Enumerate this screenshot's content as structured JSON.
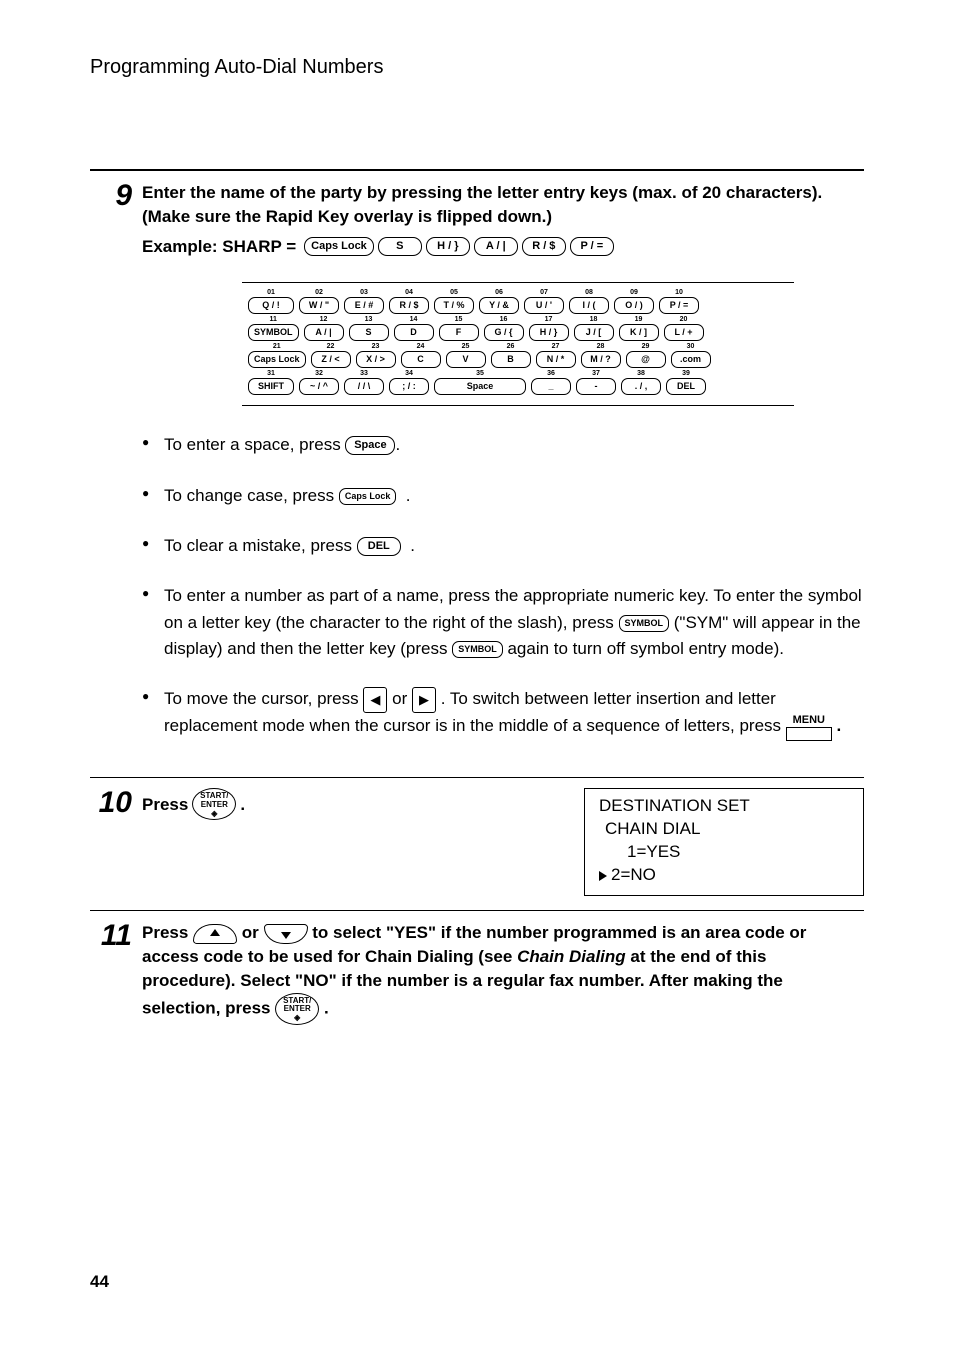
{
  "header": "Programming Auto-Dial Numbers",
  "step9": {
    "num": "9",
    "instruction_line1": "Enter the name of the party by pressing the letter entry keys (max. of 20 characters). (Make sure the Rapid Key overlay is flipped down.)",
    "example_prefix": "Example: SHARP =",
    "example_keys": [
      "Caps Lock",
      "S",
      "H / }",
      "A / |",
      "R / $",
      "P / ="
    ],
    "keyboard": {
      "row1": [
        {
          "n": "01",
          "l": "Q / !"
        },
        {
          "n": "02",
          "l": "W / \""
        },
        {
          "n": "03",
          "l": "E / #"
        },
        {
          "n": "04",
          "l": "R / $"
        },
        {
          "n": "05",
          "l": "T / %"
        },
        {
          "n": "06",
          "l": "Y / &"
        },
        {
          "n": "07",
          "l": "U / '"
        },
        {
          "n": "08",
          "l": "I / ("
        },
        {
          "n": "09",
          "l": "O / )"
        },
        {
          "n": "10",
          "l": "P / ="
        }
      ],
      "row2": [
        {
          "n": "11",
          "l": "SYMBOL"
        },
        {
          "n": "12",
          "l": "A / |"
        },
        {
          "n": "13",
          "l": "S"
        },
        {
          "n": "14",
          "l": "D"
        },
        {
          "n": "15",
          "l": "F"
        },
        {
          "n": "16",
          "l": "G / {"
        },
        {
          "n": "17",
          "l": "H / }"
        },
        {
          "n": "18",
          "l": "J / ["
        },
        {
          "n": "19",
          "l": "K / ]"
        },
        {
          "n": "20",
          "l": "L / +"
        }
      ],
      "row3": [
        {
          "n": "21",
          "l": "Caps Lock"
        },
        {
          "n": "22",
          "l": "Z / <"
        },
        {
          "n": "23",
          "l": "X / >"
        },
        {
          "n": "24",
          "l": "C"
        },
        {
          "n": "25",
          "l": "V"
        },
        {
          "n": "26",
          "l": "B"
        },
        {
          "n": "27",
          "l": "N / *"
        },
        {
          "n": "28",
          "l": "M / ?"
        },
        {
          "n": "29",
          "l": "@"
        },
        {
          "n": "30",
          "l": ".com"
        }
      ],
      "row4": [
        {
          "n": "31",
          "l": "SHIFT"
        },
        {
          "n": "32",
          "l": "~ / ^"
        },
        {
          "n": "33",
          "l": "/ / \\"
        },
        {
          "n": "34",
          "l": "; / :"
        },
        {
          "n": "35",
          "l": "Space"
        },
        {
          "n": "36",
          "l": "_"
        },
        {
          "n": "37",
          "l": "-"
        },
        {
          "n": "38",
          "l": ". / ,"
        },
        {
          "n": "39",
          "l": "DEL"
        }
      ]
    },
    "bullets": {
      "b1_pre": "To enter a space, press ",
      "b1_key": "Space",
      "b2_pre": "To change case, press ",
      "b2_key": "Caps Lock",
      "b3_pre": "To clear a mistake, press ",
      "b3_key": "DEL",
      "b4_pre": "To enter a number as part of a name, press the appropriate numeric key. To enter the symbol on a letter key (the character to the right of the slash), press ",
      "b4_key1": "SYMBOL",
      "b4_mid": " (\"SYM\" will appear in the display) and then the letter key (press ",
      "b4_key2": "SYMBOL",
      "b4_post": " again to turn off symbol entry mode).",
      "b5_pre": "To move the cursor, press ",
      "b5_mid1": " or ",
      "b5_mid2": " . To switch between letter insertion and letter replacement mode when the cursor is in the middle of a sequence of letters, press ",
      "b5_menukey": "MENU"
    }
  },
  "step10": {
    "num": "10",
    "press": "Press",
    "start_top": "START/",
    "start_bot": "ENTER",
    "display": {
      "l1": "DESTINATION SET",
      "l2": "CHAIN DIAL",
      "l3": "1=YES",
      "l4": "2=NO"
    }
  },
  "step11": {
    "num": "11",
    "t1": "Press ",
    "t2": " or ",
    "t3": " to select \"YES\" if the number programmed is an area code or access code to be used for Chain Dialing (see ",
    "t3b": "Chain Dialing",
    "t4": " at the end of this procedure). Select \"NO\" if the number is a regular fax number.  After making the selection, press ",
    "start_top": "START/",
    "start_bot": "ENTER"
  },
  "page_number": "44"
}
